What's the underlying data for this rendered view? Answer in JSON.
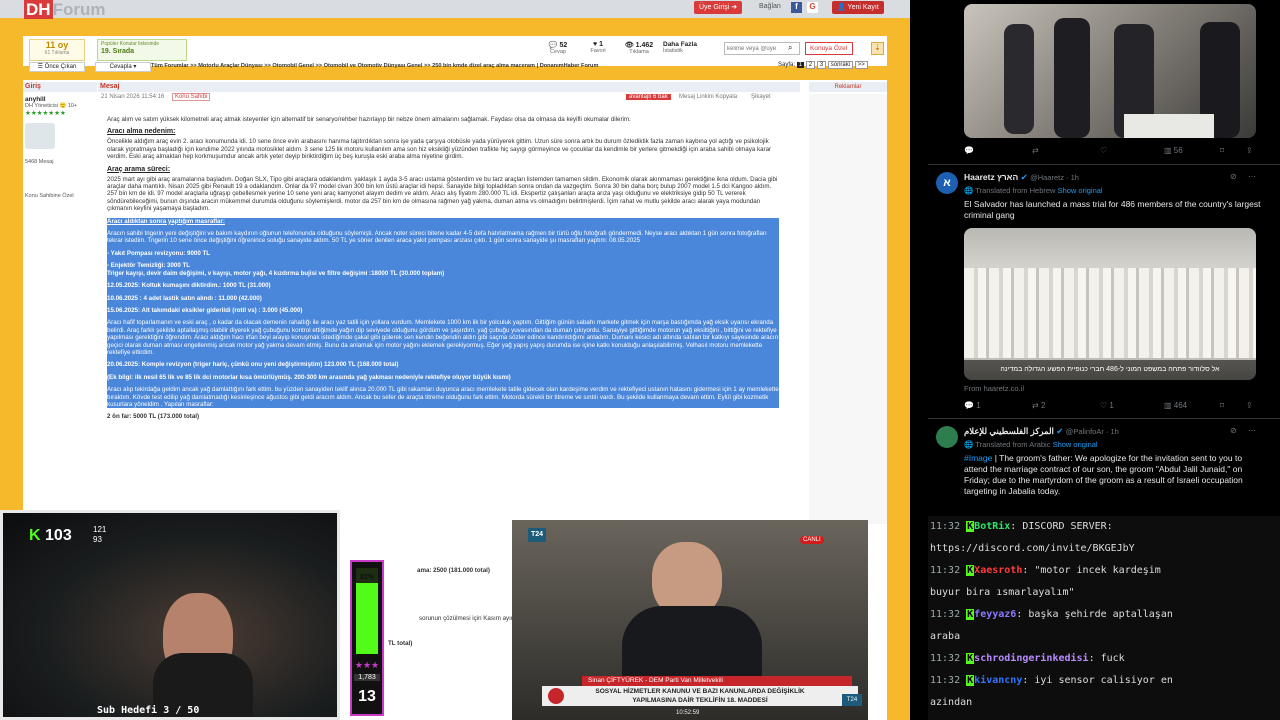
{
  "forum": {
    "logo_dh": "DH",
    "logo_forum": "Forum",
    "header": {
      "login": "Üye Girişi",
      "connect": "Bağlan",
      "fb": "f",
      "google": "G",
      "new_account": "Yeni Kayıt"
    },
    "stats": {
      "age": "11 oy",
      "age_sub": "61 Tıklama",
      "rank": "19. Sırada",
      "rank_sub": "Popüler Konular listesinde",
      "replies": "52",
      "replies_l": "Cevap",
      "favs": "1",
      "favs_l": "Favori",
      "views": "1.462",
      "views_l": "Tıklama",
      "more": "Daha Fazla",
      "more_sub": "İstatistik",
      "search_placeholder": "kelime veya @üye",
      "topic_btn": "Konuya Özel"
    },
    "buttons": {
      "prev_topic": "Önce Çıkan",
      "reply": "Cevapla"
    },
    "breadcrumb": "Tüm Forumlar >> Motorlu Araçlar Dünyası >> Otomobil Genel >> Otomobil ve Otomotiv Dünyası Genel >> 250 bin kmde dizel araç alma maceram | DonanımHaber Forum",
    "pagination": {
      "label": "Sayfa:",
      "p1": "1",
      "p2": "2",
      "p3": "3",
      "next": "sonraki",
      "last": ">>"
    },
    "table": {
      "col_login": "Giriş",
      "col_message": "Mesaj",
      "ads": "Reklamlar"
    },
    "user": {
      "name": "anyhill",
      "role": "DH Yöneticisi 🙂 10+",
      "msgs": "5468 Mesaj",
      "owner": "Konu Sahibine Özel"
    },
    "post_meta": {
      "date": "21 Nisan 2026 11:54:16",
      "quote": "Konu Sahibi",
      "badge": "avantajlı 6 bak",
      "link": "Mesaj Linkini Kopyala",
      "report": "Şikayet"
    },
    "post": {
      "intro": "Araç alım ve satım yüksek kilometreli araç almak isteyenler için alternatif bir senaryo/rehber hazırlayıp bir nebze önem almalarını sağlamak. Faydası olsa da olmasa da keyifli okumalar dilerim.",
      "h1": "Aracı alma nedenim:",
      "p1": "Öncelikle aldığım araç evin 2. aracı konumunda idi. 10 sene önce evin arabasını hanıma taptırdıktan sonra işe yada çarşıya otobüsle yada yürüyerek gittim. Uzun süre sonra artık bu durum özlediktik fazla zaman kaybına yol açtığı ve psikolojik olarak yıpratmaya başladığı için kendime 2022 yılında motosiklet aldım. 3 sene 125 lik motoru kullanılım ama son hiz eksikliği yüzünden trafikte hiç sayıgı görmeyince ve çocuklar da kendimle bir yerlere gitmekdiği için araba sahibi olmaya karar verdim. Eski araç almaktan hep korkmuşumdur ancak artık yeter deyip biriktirdiğim üç beş kuruşla eski araba alma niyetine girdim.",
      "h2": "Araç arama süreci:",
      "p2": "2025 mart ayı gibi araç aramalarına başladım. Doğan SLX, Tipo gibi araçlara odaklandım. yaklaşık 1 ayda 3-5 aracı ustama gösterdim ve bu tarz araçları listemden tamamen sildim. Ekonomik olarak akınmaması gerektiğine ikna oldum. Dacia gibi araçlar daha mantıklı. Nisan 2025 gibi Renault 19 a odaklandım. Onlar da 97 model civarı 300 bin km üstü araçlar idi hepsi. Sanayide bilgi topladıktan sonra ondan da vazgeçtim. Sonra 30 bin daha borç bulup 2007 model 1.5 dci Kangoo aldım. 257 bin km de idi. 97 model araçlarla uğraşıp çebellesmek yerine 10 sene yeni araç kamyonet alayım dedim ve aldım. Aracı alış fiyatım 280.000 TL idi. Ekspertiz çalışanları araçta arıza yaşı olduğunu ve elektriksiye gidip 50 TL vererek söndürebileceğimi, bunun dışında aracın mükemmel durumda olduğunu söylemişlerdi. motor da 257 bin km de olmasına rağmen yağ yakma, duman atma vs olmadığını belirtmişlerdi. İçim rahat ve mutlu şekilde aracı alarak yaya modundan çıkmanın keyfini yaşamaya başladım.",
      "s_h": "Aracı aldıktan sonra yaptığım masraflar:",
      "s1": "Aracın sahibi trigerin yeni değiştiğini ve bakım kaydının oğlunun telefonunda olduğunu söylemişti. Ancak noter süreci bitene kadar 4-5 defa hatırlatmama rağmen bir türlü oğlu fotoğrafı göndermedi. Neyse aracı aldıktan 1 gün sonra fotoğrafları tekrar istedim. Trigerin 10 sene önce değiştiğini öğrenince soluğu sanayide aldım. 50 TL ye söner denilen araca yakıt pompası arızası çıktı. 1 gün sonra sanayide şu masrafları yaptım: 08.05.2025",
      "s2": "- Yakıt Pompası revizyonu: 9000 TL",
      "s3": "- Enjektör Temizliği: 3000 TL",
      "s4": "Triger kayışı, devir daim değişimi, v kayışı, motor yağı, 4 kızdırma bujisi ve filtre değişimi :18000 TL (30.000 toplam)",
      "s5": "12.05.2025: Koltuk kumaşını diktirdim.: 1000 TL (31.000)",
      "s6": "10.06.2025 : 4 adet lastik satın alındı : 11.000 (42.000)",
      "s7": "15.06.2025: Alt takımdaki eksikler giderildi (rotil vs) : 3.000 (45.000)",
      "s8": "Aracı hafif toparlamanın ve eski araç , o kadar da olacak demenin rahatlığı ile aracı yaz tatili için yollara vurdum. Memlekete 1000 km lik bir yolculuk yaptım. Gittiğim günün sabahı markete gitmek için marşa bastığımda yağ eksik uyarısı ekranda belirdi. Araç farklı şekilde aptallaşmış olabilir diyerek yağ çubuğunu kontrol ettiğimde yağın dip seviyede olduğunu gördüm ve şaşırdım. yağ çubuğu yuvasından da duman çıkıyordu. Sanayiye gittiğimde motorun yağ eksiltiğini , bittiğini ve rektefiye yapılması gerektiğini öğrendim. Aracı aldığım hacı irfan beyi arayıp konuşmak istediğimde çakal gibi gülerek sen kendin beğendin aldın gibi saçma sözler edince kandırıldığımı anladım. Dumanı kesici adı altında satılan bir katkıyı sayesinde aracın geçici olarak duman atması engellenmiş ancak motor yağ yakma devam etmiş. Bunu da anlamak için motor yağını eklemek gerekiyormuş. Eğer yağ yapış yapış durumda ise içine katkı konulduğu anlaşılabilirmiş. Velhasıl motoru memlekette rektefiye ettirdim.",
      "s9": "20.06.2025: Komple revizyon (triger hariç, çünkü onu yeni değiştirmiştim) 123.000 TL (168.000 total)",
      "s10": "(Ek bilgi: ilk nesil 65 lik ve 85 lik dci motorlar kısa ömürlüymüş. 200-300 km arasında yağ yakması nedeniyle rektefiye oluyor büyük kısmı)",
      "s11": "Aracı alıp tekirdağa geldim ancak yağ damlattığını fark ettim. bu yüzden sanayiden teklif alınca 20.000 TL gibi rakamları duyunca aracı memlekete tatile gidecek olan kardeşime verdim ve rektefiyeci ustanın hatasını gidermesi için 1 ay memlekette bıraktım. Kövde test edilip yağ damlatmadığı kesinleşince ağustos gibi geldi aracım aldım. Ancak bu sefer de araçta titreme olduğunu fark ettim. Motorda sürekli bir titreme ve sıntılı vardı. Bu şekilde kullanmaya devam ettim. Eylül gibi kozmetik kusurlara yöneldim . Yapılan masraflar:",
      "after": "2 ön far: 5000 TL (173.000 total)",
      "after2": "ama: 2500 (181.000 total)",
      "after3": "sorunun çözülmesi için Kasım ayında y",
      "after4": "TL total)"
    }
  },
  "twitter": {
    "t1_likes": "56",
    "t2": {
      "name": "Haaretz הארץ",
      "handle": "@Haaretz · 1h",
      "translated": "Translated from Hebrew",
      "show_original": "Show original",
      "text": "El Salvador has launched a mass trial for 486 members of the country's largest criminal gang",
      "caption": "אל סלוודור פתחה במשפט המוני ל-486 חברי כנופיית הפשע הגדולה במדינה",
      "source": "From haaretz.co.il",
      "replies": "1",
      "retweets": "2",
      "likes": "1",
      "views": "464"
    },
    "t3": {
      "name": "المركز الفلسطيني للإعلام",
      "handle": "@PalinfoAr · 1h",
      "translated": "Translated from Arabic",
      "show_original": "Show original",
      "tag": "#Image",
      "text": " | The groom's father: We apologize for the invitation sent to you to attend the marriage contract of our son, the groom \"Abdul Jalil Junaid,\" on Friday; due to the martyrdom of the groom as a result of Israeli occupation targeting in Jabalia today."
    }
  },
  "chat": [
    {
      "time": "11:32",
      "user": "BotRix",
      "color": "#2ee36b",
      "text": "DISCORD SERVER:"
    },
    {
      "time": "",
      "user": "",
      "color": "#ddd",
      "text": "https://discord.com/invite/BKGEJbY"
    },
    {
      "time": "11:32",
      "user": "Xaesroth",
      "color": "#ff3b3b",
      "text": "\"motor incek kardeşim"
    },
    {
      "time": "",
      "user": "",
      "color": "#ddd",
      "text": "buyur bira ısmarlayalım\""
    },
    {
      "time": "11:32",
      "user": "feyyaz6",
      "color": "#8a79ff",
      "text": "başka şehirde aptallaşan"
    },
    {
      "time": "",
      "user": "",
      "color": "#ddd",
      "text": "araba"
    },
    {
      "time": "11:32",
      "user": "schrodingerinkedisi",
      "color": "#b98bff",
      "text": "fuck"
    },
    {
      "time": "11:32",
      "user": "kivancny",
      "color": "#2f74ff",
      "text": "iyi sensor calisiyor en"
    },
    {
      "time": "",
      "user": "",
      "color": "#ddd",
      "text": "azindan"
    }
  ],
  "stream": {
    "kick_count": "103",
    "stat1": "121",
    "stat2": "93",
    "sub_goal": "Sub Hedefi 3 / 50",
    "bar_percent": "82%",
    "bar_fill": 0.82,
    "stars": "★★★",
    "score": "1,783",
    "level": "13"
  },
  "video": {
    "channel": "T24",
    "name": "Sinan ÇİFTYÜREK - DEM Parti Van Milletvekili",
    "title": "SOSYAL HİZMETLER KANUNU VE BAZI KANUNLARDA DEĞİŞİKLİK",
    "title2": "YAPILMASINA DAİR TEKLİFİN 18. MADDESİ",
    "live": "CANLI",
    "corner": "T24",
    "time": "10:52:59"
  },
  "colors": {
    "forum_bg": "#f6b92c",
    "accent": "#d93a3a",
    "selection": "#4a86d9",
    "kick_green": "#53fc18"
  }
}
